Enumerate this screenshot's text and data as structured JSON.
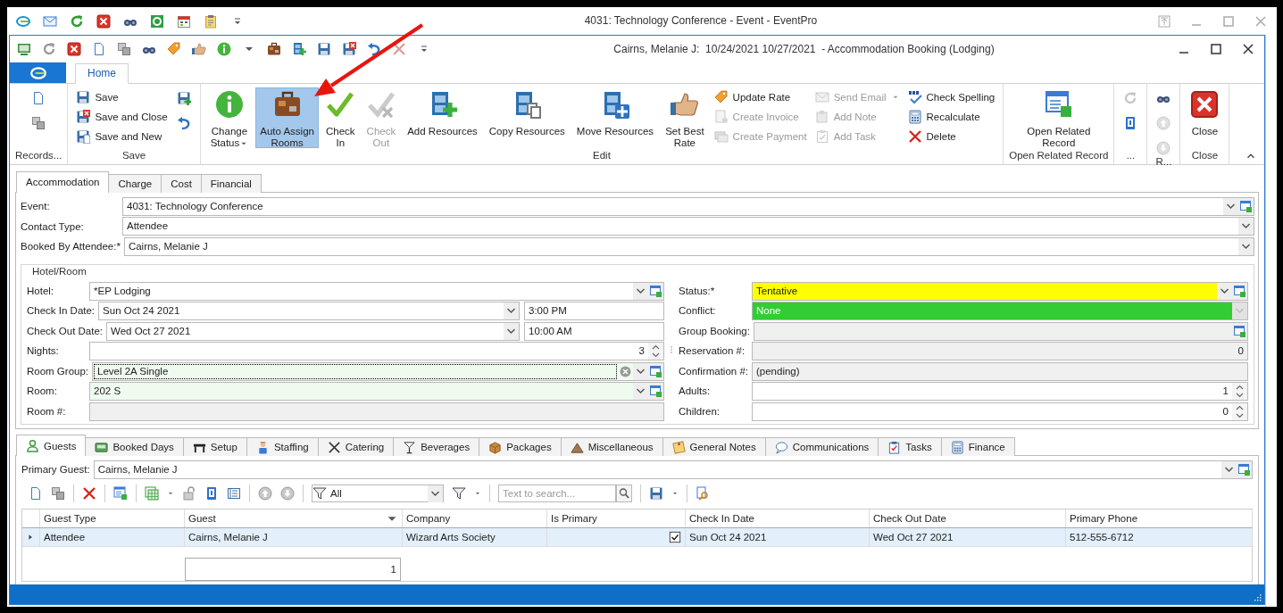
{
  "app_window": {
    "title": "4031: Technology Conference - Event - EventPro"
  },
  "document_window": {
    "title": "Cairns, Melanie J:  10/24/2021 10/27/2021  - Accommodation Booking (Lodging)"
  },
  "ribbon": {
    "tabs": [
      {
        "label": "Home",
        "selected": true
      }
    ],
    "groups": [
      {
        "label": "Records...",
        "columns": [
          [
            {
              "kind": "icon",
              "disabled": false
            },
            {
              "kind": "icon",
              "disabled": false
            }
          ]
        ]
      },
      {
        "label": "Save",
        "columns": [
          [
            {
              "kind": "small",
              "label": "Save",
              "disabled": false
            },
            {
              "kind": "small",
              "label": "Save and Close",
              "disabled": false
            },
            {
              "kind": "small",
              "label": "Save and New",
              "disabled": false
            }
          ],
          [
            {
              "kind": "icon",
              "disabled": false
            },
            {
              "kind": "icon",
              "disabled": false
            }
          ]
        ]
      },
      {
        "label": "Edit",
        "columns": [
          [
            {
              "kind": "large",
              "label": "Change\nStatus",
              "dropdown": true,
              "disabled": false,
              "highlighted": false
            }
          ],
          [
            {
              "kind": "large",
              "label": "Auto Assign\nRooms",
              "disabled": false,
              "highlighted": true
            }
          ],
          [
            {
              "kind": "large",
              "label": "Check\nIn",
              "disabled": false,
              "highlighted": false
            }
          ],
          [
            {
              "kind": "large",
              "label": "Check\nOut",
              "disabled": true,
              "highlighted": false
            }
          ],
          [
            {
              "kind": "large",
              "label": "Add Resources",
              "disabled": false,
              "highlighted": false
            }
          ],
          [
            {
              "kind": "large",
              "label": "Copy Resources",
              "disabled": false,
              "highlighted": false
            }
          ],
          [
            {
              "kind": "large",
              "label": "Move Resources",
              "disabled": false,
              "highlighted": false
            }
          ],
          [
            {
              "kind": "large",
              "label": "Set Best\nRate",
              "disabled": false,
              "highlighted": false
            }
          ],
          [
            {
              "kind": "small",
              "label": "Update Rate",
              "disabled": false
            },
            {
              "kind": "small",
              "label": "Create Invoice",
              "disabled": true
            },
            {
              "kind": "small",
              "label": "Create Payment",
              "disabled": true
            }
          ],
          [
            {
              "kind": "small",
              "label": "Send Email",
              "dropdown": true,
              "disabled": true
            },
            {
              "kind": "small",
              "label": "Add Note",
              "disabled": true
            },
            {
              "kind": "small",
              "label": "Add Task",
              "disabled": true
            }
          ],
          [
            {
              "kind": "small",
              "label": "Check Spelling",
              "disabled": false
            },
            {
              "kind": "small",
              "label": "Recalculate",
              "disabled": false
            },
            {
              "kind": "small",
              "label": "Delete",
              "disabled": false
            }
          ]
        ]
      },
      {
        "label": "Open Related Record",
        "columns": [
          [
            {
              "kind": "large",
              "label": "Open Related\nRecord",
              "disabled": false,
              "highlighted": false
            }
          ]
        ]
      },
      {
        "label": "...",
        "columns": [
          [
            {
              "kind": "icon",
              "disabled": true
            },
            {
              "kind": "icon",
              "disabled": false
            }
          ]
        ]
      },
      {
        "label": "R...",
        "columns": [
          [
            {
              "kind": "icon",
              "disabled": false
            },
            {
              "kind": "icon",
              "disabled": true
            },
            {
              "kind": "icon",
              "disabled": true
            }
          ]
        ]
      },
      {
        "label": "Close",
        "columns": [
          [
            {
              "kind": "large",
              "label": "Close",
              "disabled": false,
              "highlighted": false
            }
          ]
        ]
      }
    ]
  },
  "form_tabs": [
    {
      "label": "Accommodation",
      "selected": true
    },
    {
      "label": "Charge",
      "selected": false
    },
    {
      "label": "Cost",
      "selected": false
    },
    {
      "label": "Financial",
      "selected": false
    }
  ],
  "event_fields": [
    {
      "label": "Event:",
      "kind": "combo",
      "value": "4031: Technology Conference",
      "lookup": true
    },
    {
      "label": "Contact Type:",
      "kind": "combo",
      "value": "Attendee"
    },
    {
      "label": "Booked By Attendee:*",
      "kind": "combo",
      "value": "Cairns, Melanie J"
    }
  ],
  "hotel_room": {
    "title": "Hotel/Room",
    "left": [
      {
        "label": "Hotel:",
        "kind": "combo",
        "value": "*EP Lodging",
        "lookup": true
      },
      {
        "label": "Check In Date:",
        "kind": "datetime",
        "value": "Sun Oct 24 2021",
        "time": "3:00 PM"
      },
      {
        "label": "Check Out Date:",
        "kind": "datetime",
        "value": "Wed Oct 27 2021",
        "time": "10:00 AM"
      },
      {
        "label": "Nights:",
        "kind": "spin",
        "value": "3"
      },
      {
        "label": "Room Group:",
        "kind": "combo",
        "value": "Level 2A Single",
        "lookup": true,
        "clear": true,
        "focused": true,
        "color": "#f0fbf0"
      },
      {
        "label": "Room:",
        "kind": "combo",
        "value": "202 S",
        "lookup": true,
        "color": "#f0fbf0"
      },
      {
        "label": "Room #:",
        "kind": "readonly"
      }
    ],
    "right": [
      {
        "label": "Status:*",
        "kind": "combo",
        "value": "Tentative",
        "lookup": true,
        "color": "#ffff00"
      },
      {
        "label": "Conflict:",
        "kind": "combo",
        "value": "None",
        "disabled": true,
        "color": "#33cc33"
      },
      {
        "label": "Group Booking:",
        "kind": "readonly",
        "lookup": true
      },
      {
        "label": "Reservation #:",
        "kind": "readonly",
        "value": "0",
        "numeric": true
      },
      {
        "label": "Confirmation #:",
        "kind": "readonly",
        "value": "(pending)"
      },
      {
        "label": "Adults:",
        "kind": "spin",
        "value": "1"
      },
      {
        "label": "Children:",
        "kind": "spin",
        "value": "0"
      }
    ]
  },
  "detail_tabs": [
    {
      "label": "Guests",
      "selected": true
    },
    {
      "label": "Booked Days",
      "selected": false
    },
    {
      "label": "Setup",
      "selected": false
    },
    {
      "label": "Staffing",
      "selected": false
    },
    {
      "label": "Catering",
      "selected": false
    },
    {
      "label": "Beverages",
      "selected": false
    },
    {
      "label": "Packages",
      "selected": false
    },
    {
      "label": "Miscellaneous",
      "selected": false
    },
    {
      "label": "General Notes",
      "selected": false
    },
    {
      "label": "Communications",
      "selected": false
    },
    {
      "label": "Tasks",
      "selected": false
    },
    {
      "label": "Finance",
      "selected": false
    }
  ],
  "primary_guest": {
    "label": "Primary Guest:",
    "kind": "combo",
    "value": "Cairns, Melanie J",
    "lookup": true
  },
  "guests_toolbar": {
    "filter": "All",
    "search_placeholder": "Text to search..."
  },
  "guests_grid": {
    "columns": [
      {
        "label": "Guest Type",
        "kind": "text",
        "sorted": false
      },
      {
        "label": "Guest",
        "kind": "text",
        "sorted": true,
        "summary": "1"
      },
      {
        "label": "Company",
        "kind": "text",
        "sorted": false
      },
      {
        "label": "Is Primary",
        "kind": "check",
        "sorted": false
      },
      {
        "label": "Check In Date",
        "kind": "text",
        "sorted": false
      },
      {
        "label": "Check Out Date",
        "kind": "text",
        "sorted": false
      },
      {
        "label": "Primary Phone",
        "kind": "text",
        "sorted": false
      }
    ],
    "rows": [
      {
        "selected": true,
        "cells": [
          "Attendee",
          "Cairns, Melanie J",
          "Wizard Arts Society",
          true,
          "Sun Oct 24 2021",
          "Wed Oct 27 2021",
          "512-555-6712"
        ]
      }
    ]
  }
}
